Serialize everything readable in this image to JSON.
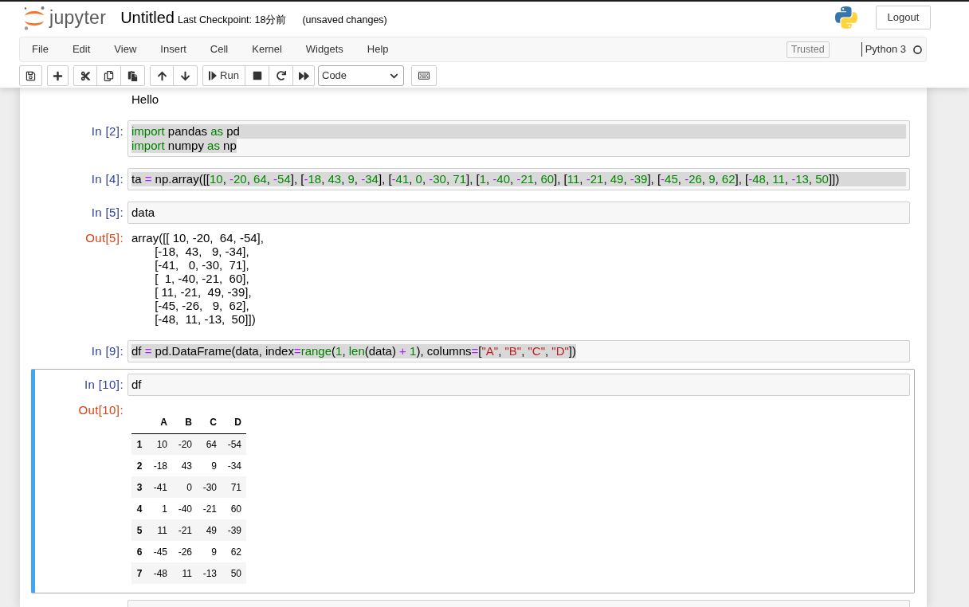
{
  "header": {
    "logo_text": "jupyter",
    "notebook_title": "Untitled",
    "checkpoint": "Last Checkpoint: 18分前",
    "save_status": "(unsaved changes)",
    "logout_button": "Logout"
  },
  "menu_bar": {
    "items": [
      "File",
      "Edit",
      "View",
      "Insert",
      "Cell",
      "Kernel",
      "Widgets",
      "Help"
    ],
    "trusted_indicator": "Trusted",
    "kernel_name": "Python 3",
    "kernel_busy": false
  },
  "toolbar": {
    "run_button": "Run",
    "cell_type": "Code"
  },
  "cells": [
    {
      "kind": "output",
      "selected": false,
      "output": {
        "kind": "text",
        "lines": [
          "Hello"
        ]
      }
    },
    {
      "kind": "code",
      "selected": false,
      "prompt": "In [2]:",
      "lines": [
        {
          "selected": true,
          "selected_past_line_end": true,
          "tokens": [
            {
              "kind": "keyword",
              "text": "import"
            },
            {
              "kind": "plain",
              "text": " pandas "
            },
            {
              "kind": "keyword",
              "text": "as"
            },
            {
              "kind": "plain",
              "text": " pd"
            }
          ]
        },
        {
          "selected": true,
          "selected_past_line_end": false,
          "tokens": [
            {
              "kind": "keyword",
              "text": "import"
            },
            {
              "kind": "plain",
              "text": " numpy "
            },
            {
              "kind": "keyword",
              "text": "as"
            },
            {
              "kind": "plain",
              "text": " np"
            }
          ]
        }
      ]
    },
    {
      "kind": "code",
      "selected": false,
      "prompt": "In [4]:",
      "lines": [
        {
          "selected": true,
          "selected_past_line_end": true,
          "tokens": [
            {
              "kind": "plain",
              "text": "ta "
            },
            {
              "kind": "operator",
              "text": "="
            },
            {
              "kind": "plain",
              "text": " np.array([["
            },
            {
              "kind": "number",
              "text": "10"
            },
            {
              "kind": "plain",
              "text": ", "
            },
            {
              "kind": "operator",
              "text": "-"
            },
            {
              "kind": "number",
              "text": "20"
            },
            {
              "kind": "plain",
              "text": ", "
            },
            {
              "kind": "number",
              "text": "64"
            },
            {
              "kind": "plain",
              "text": ", "
            },
            {
              "kind": "operator",
              "text": "-"
            },
            {
              "kind": "number",
              "text": "54"
            },
            {
              "kind": "plain",
              "text": "], ["
            },
            {
              "kind": "operator",
              "text": "-"
            },
            {
              "kind": "number",
              "text": "18"
            },
            {
              "kind": "plain",
              "text": ", "
            },
            {
              "kind": "number",
              "text": "43"
            },
            {
              "kind": "plain",
              "text": ", "
            },
            {
              "kind": "number",
              "text": "9"
            },
            {
              "kind": "plain",
              "text": ", "
            },
            {
              "kind": "operator",
              "text": "-"
            },
            {
              "kind": "number",
              "text": "34"
            },
            {
              "kind": "plain",
              "text": "], ["
            },
            {
              "kind": "operator",
              "text": "-"
            },
            {
              "kind": "number",
              "text": "41"
            },
            {
              "kind": "plain",
              "text": ", "
            },
            {
              "kind": "number",
              "text": "0"
            },
            {
              "kind": "plain",
              "text": ", "
            },
            {
              "kind": "operator",
              "text": "-"
            },
            {
              "kind": "number",
              "text": "30"
            },
            {
              "kind": "plain",
              "text": ", "
            },
            {
              "kind": "number",
              "text": "71"
            },
            {
              "kind": "plain",
              "text": "], ["
            },
            {
              "kind": "number",
              "text": "1"
            },
            {
              "kind": "plain",
              "text": ", "
            },
            {
              "kind": "operator",
              "text": "-"
            },
            {
              "kind": "number",
              "text": "40"
            },
            {
              "kind": "plain",
              "text": ", "
            },
            {
              "kind": "operator",
              "text": "-"
            },
            {
              "kind": "number",
              "text": "21"
            },
            {
              "kind": "plain",
              "text": ", "
            },
            {
              "kind": "number",
              "text": "60"
            },
            {
              "kind": "plain",
              "text": "], ["
            },
            {
              "kind": "number",
              "text": "11"
            },
            {
              "kind": "plain",
              "text": ", "
            },
            {
              "kind": "operator",
              "text": "-"
            },
            {
              "kind": "number",
              "text": "21"
            },
            {
              "kind": "plain",
              "text": ", "
            },
            {
              "kind": "number",
              "text": "49"
            },
            {
              "kind": "plain",
              "text": ", "
            },
            {
              "kind": "operator",
              "text": "-"
            },
            {
              "kind": "number",
              "text": "39"
            },
            {
              "kind": "plain",
              "text": "], ["
            },
            {
              "kind": "operator",
              "text": "-"
            },
            {
              "kind": "number",
              "text": "45"
            },
            {
              "kind": "plain",
              "text": ", "
            },
            {
              "kind": "operator",
              "text": "-"
            },
            {
              "kind": "number",
              "text": "26"
            },
            {
              "kind": "plain",
              "text": ", "
            },
            {
              "kind": "number",
              "text": "9"
            },
            {
              "kind": "plain",
              "text": ", "
            },
            {
              "kind": "number",
              "text": "62"
            },
            {
              "kind": "plain",
              "text": "], ["
            },
            {
              "kind": "operator",
              "text": "-"
            },
            {
              "kind": "number",
              "text": "48"
            },
            {
              "kind": "plain",
              "text": ", "
            },
            {
              "kind": "number",
              "text": "11"
            },
            {
              "kind": "plain",
              "text": ", "
            },
            {
              "kind": "operator",
              "text": "-"
            },
            {
              "kind": "number",
              "text": "13"
            },
            {
              "kind": "plain",
              "text": ", "
            },
            {
              "kind": "number",
              "text": "50"
            },
            {
              "kind": "plain",
              "text": "]])"
            }
          ]
        }
      ]
    },
    {
      "kind": "code",
      "selected": false,
      "prompt": "In [5]:",
      "lines": [
        {
          "selected": false,
          "tokens": [
            {
              "kind": "plain",
              "text": "data"
            }
          ]
        }
      ],
      "output": {
        "kind": "text",
        "prompt": "Out[5]:",
        "lines": [
          "array([[ 10, -20,  64, -54],",
          "       [-18,  43,   9, -34],",
          "       [-41,   0, -30,  71],",
          "       [  1, -40, -21,  60],",
          "       [ 11, -21,  49, -39],",
          "       [-45, -26,   9,  62],",
          "       [-48,  11, -13,  50]])"
        ]
      }
    },
    {
      "kind": "code",
      "selected": false,
      "prompt": "In [9]:",
      "lines": [
        {
          "selected": true,
          "selected_past_line_end": false,
          "tokens": [
            {
              "kind": "plain",
              "text": "df "
            },
            {
              "kind": "operator",
              "text": "="
            },
            {
              "kind": "plain",
              "text": " pd.DataFrame(data, index"
            },
            {
              "kind": "operator",
              "text": "="
            },
            {
              "kind": "builtin",
              "text": "range"
            },
            {
              "kind": "plain",
              "text": "("
            },
            {
              "kind": "number",
              "text": "1"
            },
            {
              "kind": "plain",
              "text": ", "
            },
            {
              "kind": "builtin",
              "text": "len"
            },
            {
              "kind": "plain",
              "text": "(data) "
            },
            {
              "kind": "operator",
              "text": "+"
            },
            {
              "kind": "number",
              "text": " 1"
            },
            {
              "kind": "plain",
              "text": "), columns"
            },
            {
              "kind": "operator",
              "text": "="
            },
            {
              "kind": "plain",
              "text": "["
            },
            {
              "kind": "string",
              "text": "\"A\""
            },
            {
              "kind": "plain",
              "text": ", "
            },
            {
              "kind": "string",
              "text": "\"B\""
            },
            {
              "kind": "plain",
              "text": ", "
            },
            {
              "kind": "string",
              "text": "\"C\""
            },
            {
              "kind": "plain",
              "text": ", "
            },
            {
              "kind": "string",
              "text": "\"D\""
            },
            {
              "kind": "plain",
              "text": "])"
            }
          ]
        }
      ]
    },
    {
      "kind": "code",
      "selected": true,
      "prompt": "In [10]:",
      "lines": [
        {
          "selected": false,
          "tokens": [
            {
              "kind": "plain",
              "text": "df"
            }
          ]
        }
      ],
      "output": {
        "kind": "table",
        "prompt": "Out[10]:",
        "columns": [
          "A",
          "B",
          "C",
          "D"
        ],
        "rows": [
          {
            "index": "1",
            "values": [
              "10",
              "-20",
              "64",
              "-54"
            ]
          },
          {
            "index": "2",
            "values": [
              "-18",
              "43",
              "9",
              "-34"
            ]
          },
          {
            "index": "3",
            "values": [
              "-41",
              "0",
              "-30",
              "71"
            ]
          },
          {
            "index": "4",
            "values": [
              "1",
              "-40",
              "-21",
              "60"
            ]
          },
          {
            "index": "5",
            "values": [
              "11",
              "-21",
              "49",
              "-39"
            ]
          },
          {
            "index": "6",
            "values": [
              "-45",
              "-26",
              "9",
              "62"
            ]
          },
          {
            "index": "7",
            "values": [
              "-48",
              "11",
              "-13",
              "50"
            ]
          }
        ]
      }
    },
    {
      "kind": "code",
      "selected": false
    }
  ]
}
